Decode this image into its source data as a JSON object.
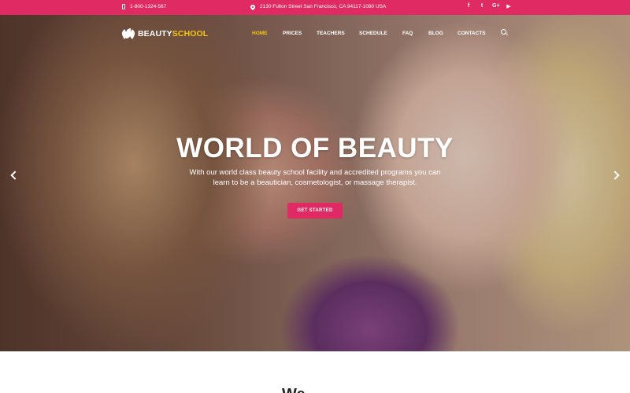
{
  "topbar": {
    "phone": "1-800-1324-567",
    "address": "2130 Fulton Street San Francisco, CA 94117-1080 USA",
    "social": [
      {
        "icon": "facebook-icon",
        "glyph": "f"
      },
      {
        "icon": "twitter-icon",
        "glyph": "t"
      },
      {
        "icon": "google-plus-icon",
        "glyph": "G+"
      },
      {
        "icon": "youtube-icon",
        "glyph": "▶"
      }
    ],
    "bg_color": "#e02a63"
  },
  "brand": {
    "part1": "BEAUTY",
    "part2": "SCHOOL",
    "accent_color": "#f5c518"
  },
  "nav": {
    "items": [
      "HOME",
      "PRICES",
      "TEACHERS",
      "SCHEDULE",
      "FAQ",
      "BLOG",
      "CONTACTS"
    ],
    "active": "HOME"
  },
  "hero": {
    "title": "WORLD OF BEAUTY",
    "text": "With our world class beauty school facility and accredited programs you can learn to be a beautician, cosmetologist, or massage therapist.",
    "cta_label": "GET STARTED"
  },
  "section": {
    "title": "We"
  }
}
